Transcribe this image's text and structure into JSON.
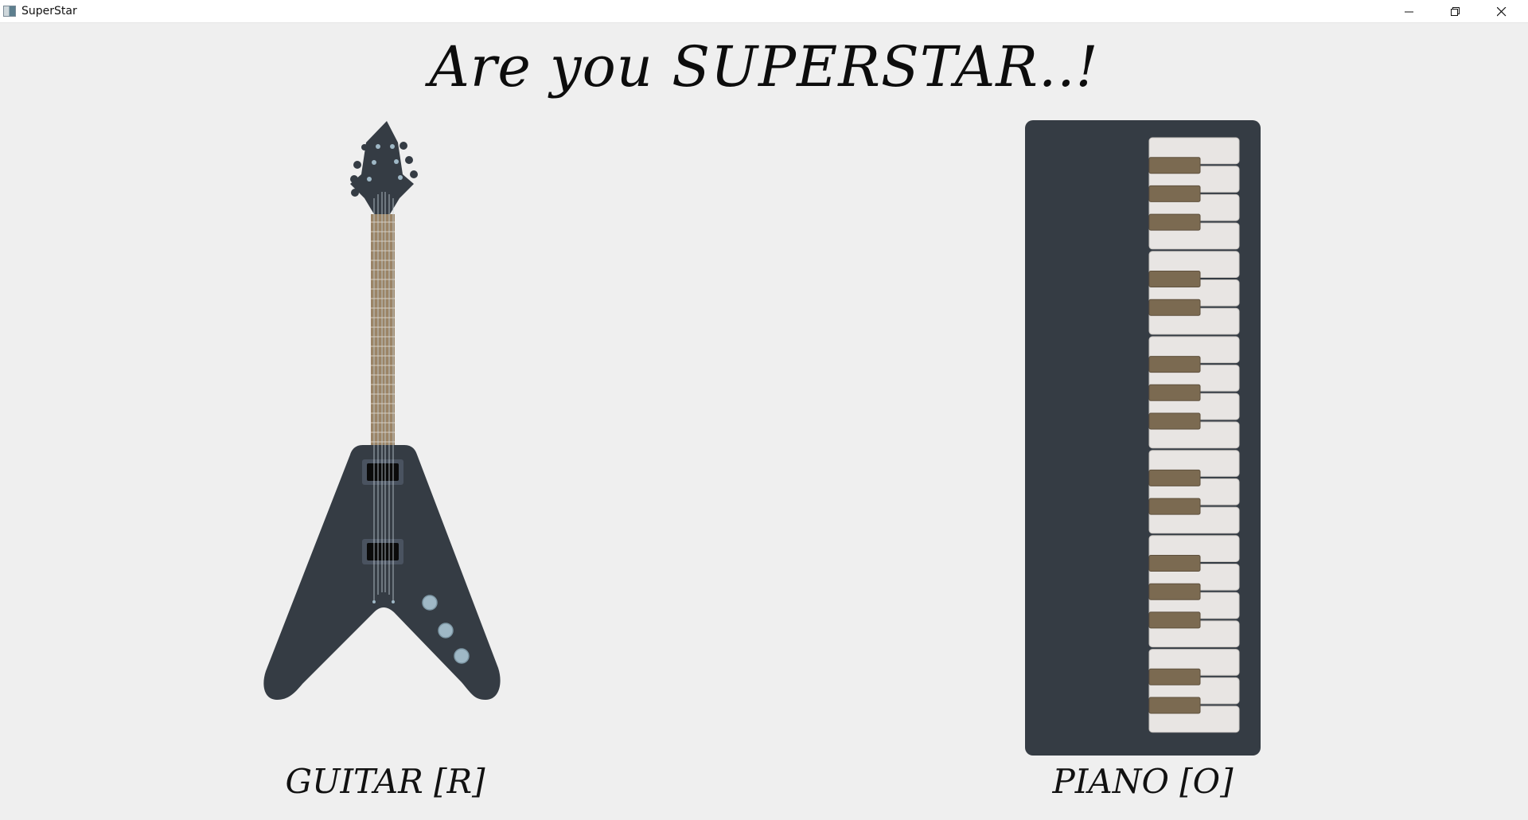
{
  "window": {
    "title": "SuperStar",
    "controls": [
      "minimize",
      "maximize",
      "close"
    ]
  },
  "heading": "Are you SUPERSTAR..!",
  "instruments": [
    {
      "name": "guitar",
      "label": "GUITAR [R]"
    },
    {
      "name": "piano",
      "label": "PIANO [O]"
    }
  ],
  "colors": {
    "background": "#efefef",
    "body_dark": "#353c44",
    "neck": "#9b8466",
    "white_key": "#e8e5e3",
    "black_key": "#7b6a51",
    "knob": "#9fb8c6"
  }
}
